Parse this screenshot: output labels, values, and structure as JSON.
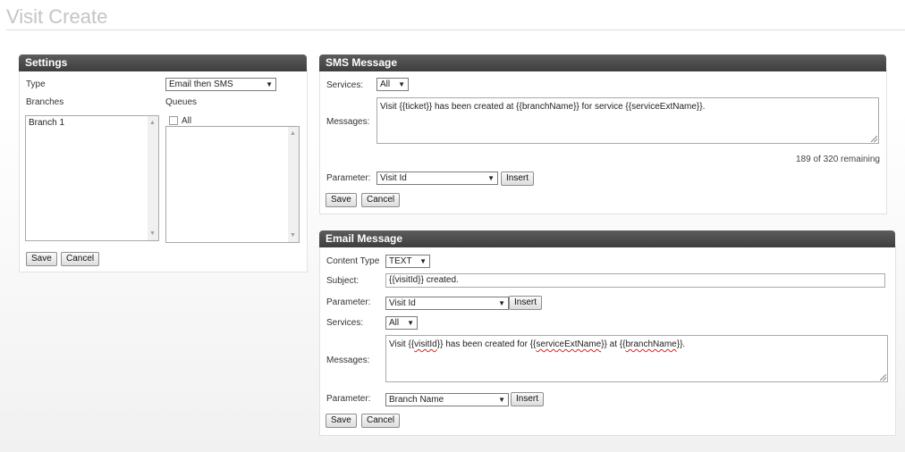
{
  "page": {
    "title": "Visit Create"
  },
  "settings": {
    "header": "Settings",
    "type_label": "Type",
    "type_value": "Email then SMS",
    "branches_label": "Branches",
    "queues_label": "Queues",
    "branches": [
      "Branch 1"
    ],
    "queues_all_label": "All",
    "save_label": "Save",
    "cancel_label": "Cancel"
  },
  "sms": {
    "header": "SMS Message",
    "services_label": "Services:",
    "services_value": "All",
    "messages_label": "Messages:",
    "message_text": "Visit {{ticket}} has been created at {{branchName}} for service {{serviceExtName}}.",
    "remaining_text": "189 of 320 remaining",
    "parameter_label": "Parameter:",
    "parameter_value": "Visit Id",
    "insert_label": "Insert",
    "save_label": "Save",
    "cancel_label": "Cancel"
  },
  "email": {
    "header": "Email Message",
    "content_type_label": "Content Type",
    "content_type_value": "TEXT",
    "subject_label": "Subject:",
    "subject_value": "{{visitId}} created.",
    "parameter_label": "Parameter:",
    "parameter_value": "Visit Id",
    "insert_label": "Insert",
    "services_label": "Services:",
    "services_value": "All",
    "messages_label": "Messages:",
    "message_parts": {
      "p1": "Visit {{",
      "w1": "visitId",
      "p2": "}} has been created for {{",
      "w2": "serviceExtName",
      "p3": "}} at {{",
      "w3": "branchName",
      "p4": "}}."
    },
    "parameter2_label": "Parameter:",
    "parameter2_value": "Branch Name",
    "insert2_label": "Insert",
    "save_label": "Save",
    "cancel_label": "Cancel"
  },
  "icons": {
    "dropdown": "chevron-down-icon",
    "scroll_up": "scroll-up-icon",
    "scroll_down": "scroll-down-icon",
    "resize": "resize-grip-icon"
  }
}
